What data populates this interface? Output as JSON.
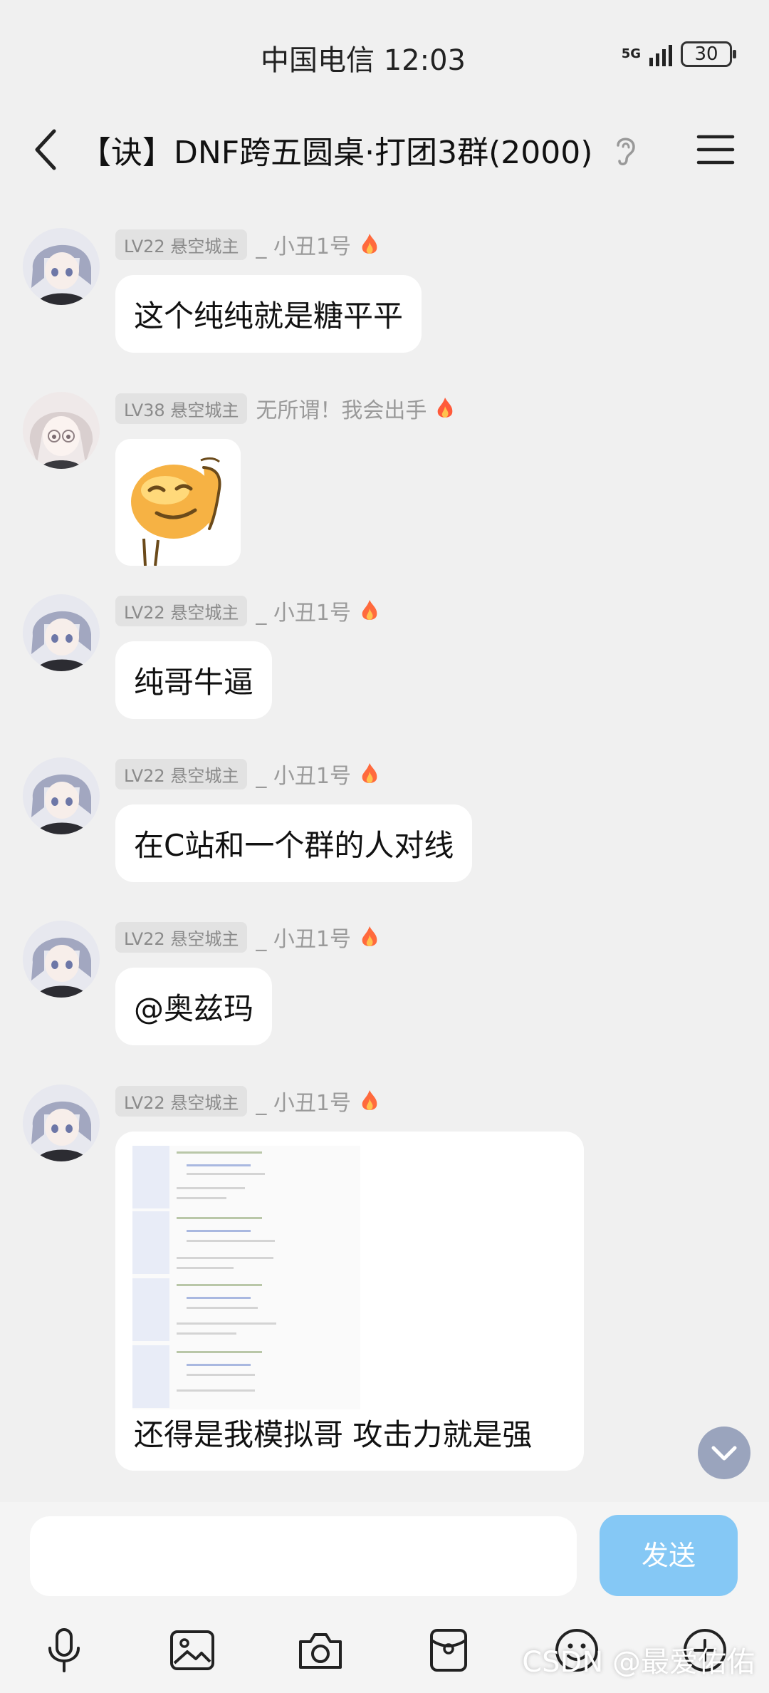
{
  "status_bar": {
    "carrier": "中国电信",
    "time": "12:03",
    "network": "5G",
    "battery": "30"
  },
  "header": {
    "title": "【诀】DNF跨五圆桌·打团3群(2000)"
  },
  "messages": [
    {
      "level_badge": "LV22 悬空城主",
      "nickname": "_  小丑1号",
      "type": "text",
      "text": "这个纯纯就是糖平平"
    },
    {
      "level_badge": "LV38 悬空城主",
      "nickname": "无所谓！我会出手",
      "type": "sticker"
    },
    {
      "level_badge": "LV22 悬空城主",
      "nickname": "_  小丑1号",
      "type": "text",
      "text": "纯哥牛逼"
    },
    {
      "level_badge": "LV22 悬空城主",
      "nickname": "_  小丑1号",
      "type": "text",
      "text": "在C站和一个群的人对线"
    },
    {
      "level_badge": "LV22 悬空城主",
      "nickname": "_  小丑1号",
      "type": "text",
      "text": "@奥兹玛"
    },
    {
      "level_badge": "LV22 悬空城主",
      "nickname": "_  小丑1号",
      "type": "image_text",
      "text": "还得是我模拟哥 攻击力就是强"
    }
  ],
  "input": {
    "value": "",
    "send_label": "发送"
  },
  "toolbar": [
    "mic-icon",
    "image-icon",
    "camera-icon",
    "red-packet-icon",
    "emoji-icon",
    "plus-icon"
  ],
  "watermark": "CSDN @最爱佑佑",
  "colors": {
    "background": "#f0f0f0",
    "send_button": "#85c8f5",
    "badge": "#e2e2e2",
    "flame": "#ff6a3d"
  }
}
